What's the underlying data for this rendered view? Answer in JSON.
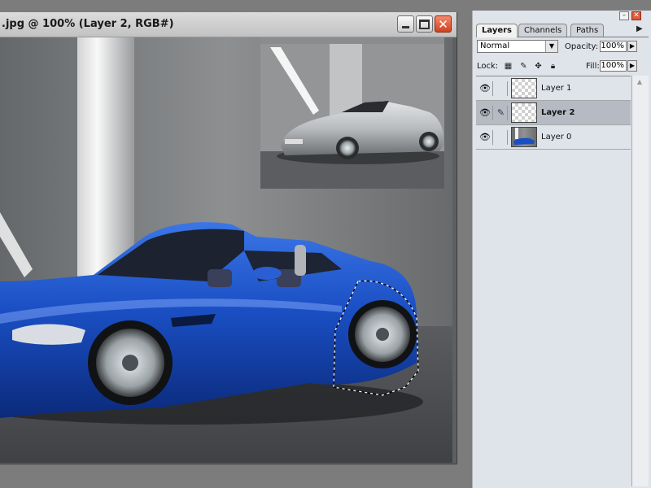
{
  "document": {
    "title": ".jpg @ 100% (Layer 2, RGB#)",
    "close_glyph": "✕"
  },
  "palette": {
    "tabs": [
      "Layers",
      "Channels",
      "Paths"
    ],
    "menu_arrow": "▶",
    "blend_mode": "Normal",
    "opacity_label": "Opacity:",
    "opacity_value": "100%",
    "lock_label": "Lock:",
    "fill_label": "Fill:",
    "fill_value": "100%",
    "layers": [
      {
        "name": "Layer 1",
        "active": false
      },
      {
        "name": "Layer 2",
        "active": true
      },
      {
        "name": "Layer 0",
        "active": false
      }
    ]
  },
  "icons": {
    "eye": "eye-icon",
    "brush": "brush-icon",
    "lock-transparent": "checker-lock-icon",
    "lock-paint": "brush-lock-icon",
    "lock-move": "move-lock-icon",
    "lock-all": "padlock-icon"
  },
  "colors": {
    "car_blue": "#1a4fc4",
    "car_silver": "#b9bcbf",
    "palette_bg": "#dfe3ea",
    "active_layer": "#b5bac3"
  }
}
